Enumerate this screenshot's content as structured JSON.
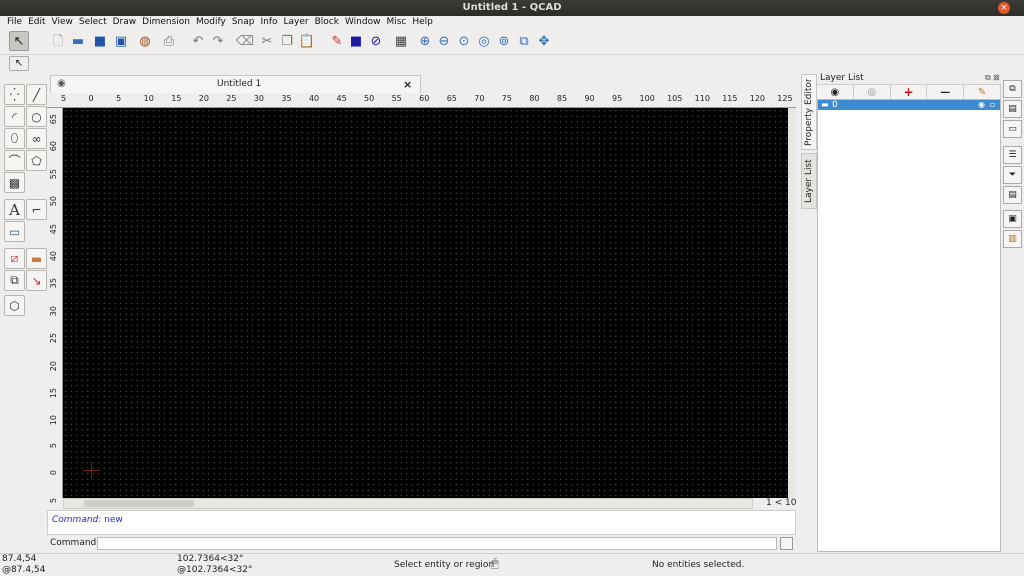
{
  "window": {
    "title": "Untitled 1 - QCAD",
    "close_glyph": "×"
  },
  "menu": [
    "File",
    "Edit",
    "View",
    "Select",
    "Draw",
    "Dimension",
    "Modify",
    "Snap",
    "Info",
    "Layer",
    "Block",
    "Window",
    "Misc",
    "Help"
  ],
  "document": {
    "tab_title": "Untitled 1",
    "tab_close": "×"
  },
  "ruler": {
    "x_ticks": [
      "5",
      "0",
      "5",
      "10",
      "15",
      "20",
      "25",
      "30",
      "35",
      "40",
      "45",
      "50",
      "55",
      "60",
      "65",
      "70",
      "75",
      "80",
      "85",
      "90",
      "95",
      "100",
      "105",
      "110",
      "115",
      "120",
      "125"
    ],
    "y_ticks": [
      "65",
      "60",
      "55",
      "50",
      "45",
      "40",
      "35",
      "30",
      "25",
      "20",
      "15",
      "10",
      "5",
      "0",
      "5"
    ]
  },
  "page_nav": "1 < 10",
  "command": {
    "history_prefix": "Command:",
    "history_value": " new",
    "label": "Command:",
    "input_value": ""
  },
  "side_tabs": {
    "property_editor": "Property Editor",
    "layer_list": "Layer List"
  },
  "layer_panel": {
    "title": "Layer List",
    "tools": [
      "show-all-icon",
      "hide-all-icon",
      "add-layer-icon",
      "remove-layer-icon",
      "edit-layer-icon"
    ],
    "layers": [
      {
        "name": "0"
      }
    ]
  },
  "status": {
    "abs_coord": "87.4,54",
    "rel_coord": "@87.4,54",
    "polar_coord": "102.7364<32°",
    "rel_polar_coord": "@102.7364<32°",
    "hint": "Select entity or region",
    "selection": "No entities selected."
  },
  "colors": {
    "canvas": "#000000",
    "grid": "#555555",
    "selection": "#3d8bd1",
    "titlebar": "#2d2c29",
    "command_history": "#1a2fb0"
  }
}
